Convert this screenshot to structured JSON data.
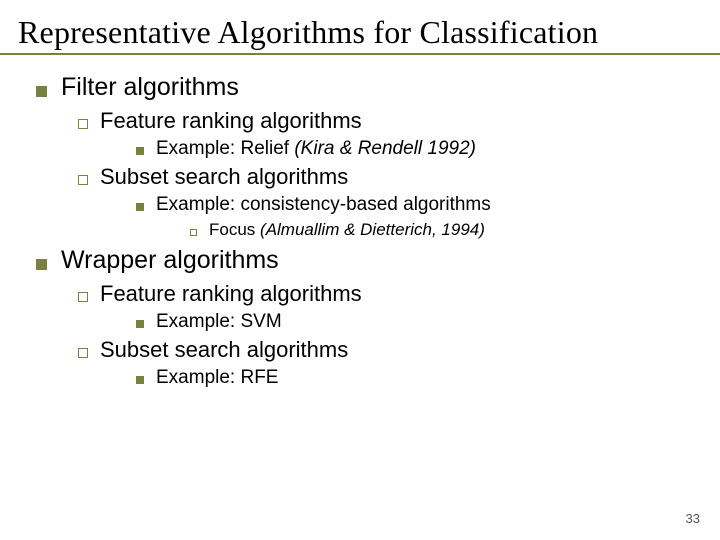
{
  "title": "Representative Algorithms for Classification",
  "sections": [
    {
      "label": "Filter algorithms",
      "sub": [
        {
          "label": "Feature ranking algorithms",
          "items": [
            {
              "prefix": "Example: Relief ",
              "italic": "(Kira & Rendell 1992)"
            }
          ]
        },
        {
          "label": "Subset search algorithms",
          "items": [
            {
              "prefix": "Example: consistency-based algorithms",
              "sub": [
                {
                  "prefix": "Focus ",
                  "italic": "(Almuallim & Dietterich, 1994)"
                }
              ]
            }
          ]
        }
      ]
    },
    {
      "label": "Wrapper algorithms",
      "sub": [
        {
          "label": "Feature ranking algorithms",
          "items": [
            {
              "prefix": "Example: SVM"
            }
          ]
        },
        {
          "label": "Subset search algorithms",
          "items": [
            {
              "prefix": "Example: RFE"
            }
          ]
        }
      ]
    }
  ],
  "page_number": "33"
}
